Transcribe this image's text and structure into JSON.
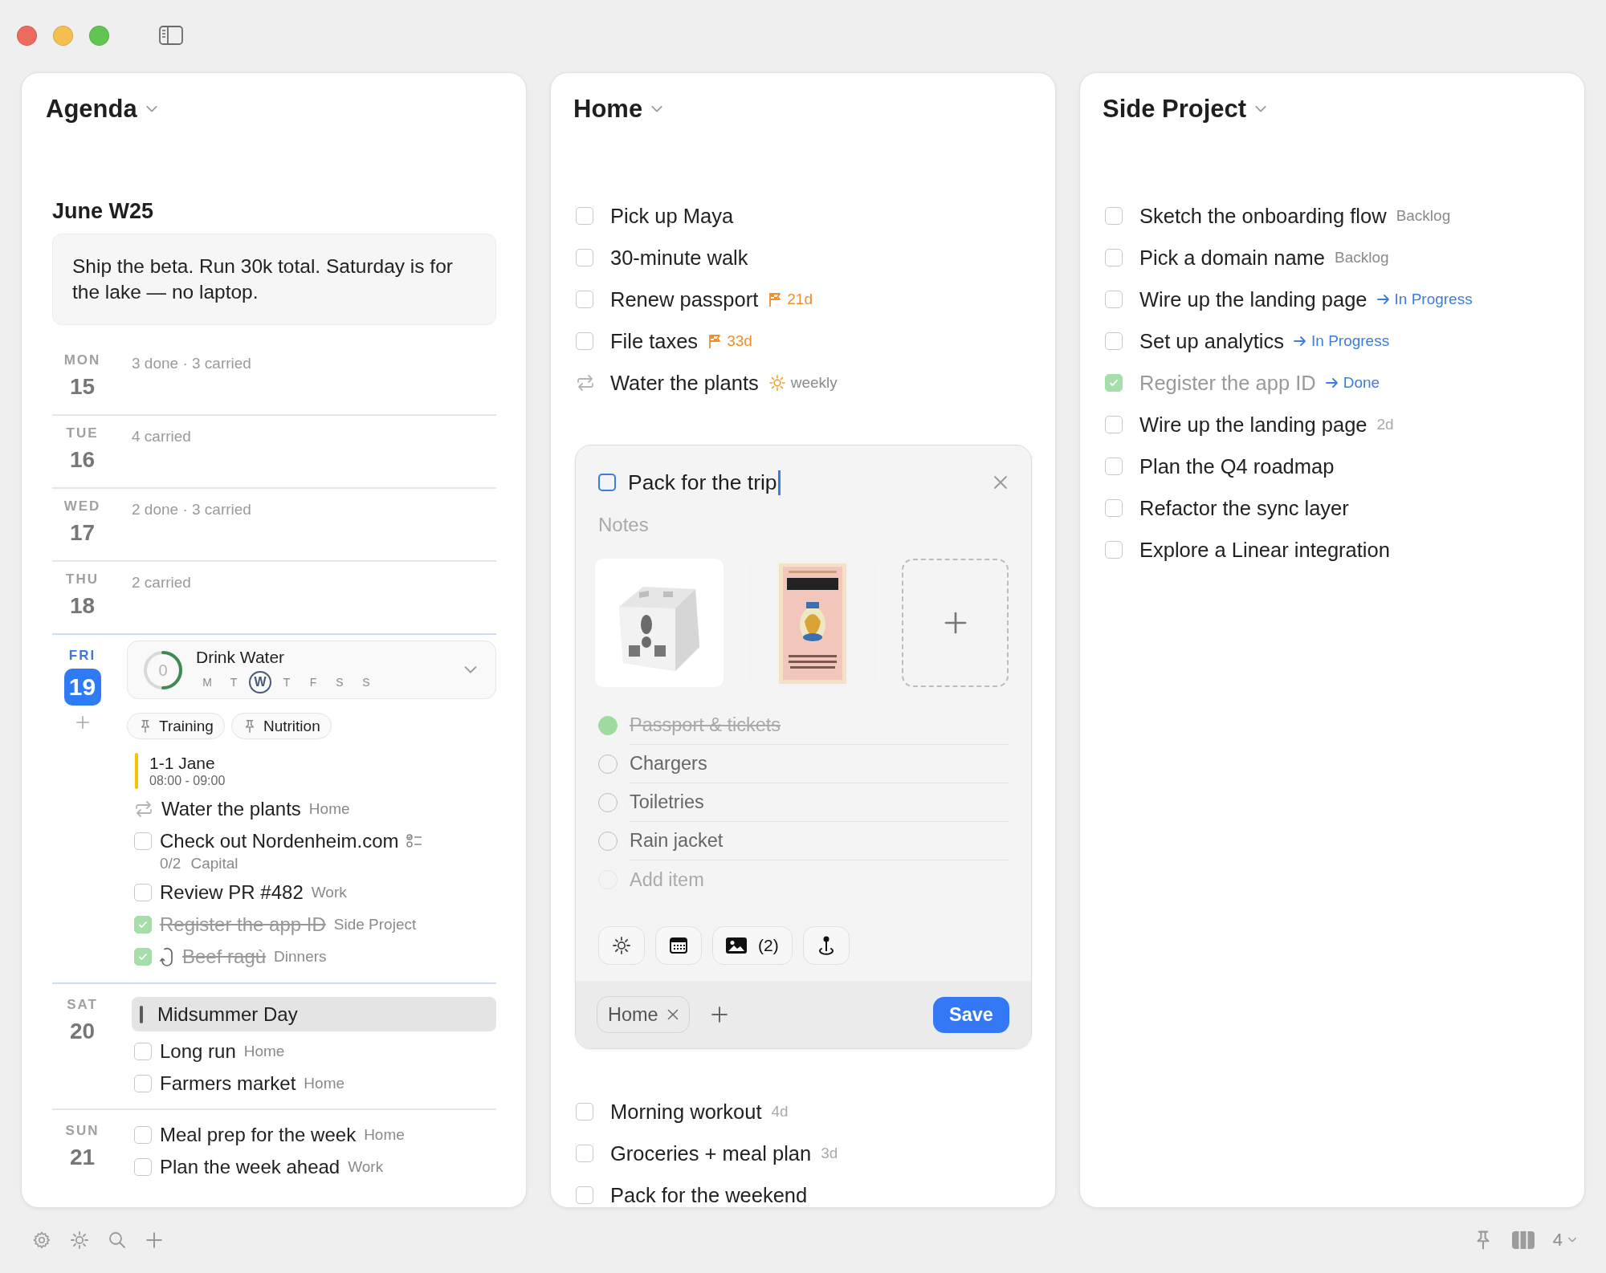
{
  "agenda": {
    "title": "Agenda",
    "week": "June W25",
    "note": "Ship the beta. Run 30k total. Saturday is for the lake — no laptop.",
    "days": [
      {
        "weekday": "MON",
        "date": "15",
        "today": false,
        "summary": "3 done · 3 carried"
      },
      {
        "weekday": "TUE",
        "date": "16",
        "today": false,
        "summary": "4 carried"
      },
      {
        "weekday": "WED",
        "date": "17",
        "today": false,
        "summary": "2 done · 3 carried"
      },
      {
        "weekday": "THU",
        "date": "18",
        "today": false,
        "summary": "2 carried"
      },
      {
        "weekday": "FRI",
        "date": "19",
        "today": true,
        "habit": {
          "name": "Drink Water",
          "count": "0",
          "days": [
            {
              "label": "M",
              "selected": false
            },
            {
              "label": "T",
              "selected": false
            },
            {
              "label": "W",
              "selected": true
            },
            {
              "label": "T",
              "selected": false
            },
            {
              "label": "F",
              "selected": false
            },
            {
              "label": "S",
              "selected": false
            },
            {
              "label": "S",
              "selected": false
            }
          ]
        },
        "pinned": [
          "Training",
          "Nutrition"
        ],
        "items": [
          {
            "kind": "event",
            "title": "1-1 Jane",
            "time": "08:00 - 09:00",
            "color": "#f5c400"
          },
          {
            "kind": "repeat",
            "title": "Water the plants",
            "meta": {
              "kind": "list",
              "text": "Home"
            }
          },
          {
            "kind": "task",
            "title": "Check out Nordenheim.com",
            "checked": false,
            "recurring": false,
            "subtasks": "0/2",
            "meta": {
              "kind": "list",
              "text": "Capital"
            }
          },
          {
            "kind": "task",
            "title": "Review PR #482",
            "checked": false,
            "recurring": false,
            "meta": {
              "kind": "list",
              "text": "Work"
            }
          },
          {
            "kind": "task",
            "title": "Register the app ID",
            "checked": true,
            "recurring": false,
            "meta": {
              "kind": "list",
              "text": "Side Project"
            }
          },
          {
            "kind": "task",
            "title": "Beef ragù",
            "checked": true,
            "recurring": true,
            "meta": {
              "kind": "list",
              "text": "Dinners"
            }
          }
        ]
      },
      {
        "weekday": "SAT",
        "date": "20",
        "today": false,
        "items": [
          {
            "kind": "holiday",
            "title": "Midsummer Day"
          },
          {
            "kind": "task",
            "title": "Long run",
            "checked": false,
            "recurring": false,
            "meta": {
              "kind": "list",
              "text": "Home"
            }
          },
          {
            "kind": "task",
            "title": "Farmers market",
            "checked": false,
            "recurring": false,
            "meta": {
              "kind": "list",
              "text": "Home"
            }
          }
        ]
      },
      {
        "weekday": "SUN",
        "date": "21",
        "today": false,
        "items": [
          {
            "kind": "task",
            "title": "Meal prep for the week",
            "checked": false,
            "recurring": false,
            "meta": {
              "kind": "list",
              "text": "Home"
            }
          },
          {
            "kind": "task",
            "title": "Plan the week ahead",
            "checked": false,
            "recurring": false,
            "meta": {
              "kind": "list",
              "text": "Work"
            }
          }
        ]
      }
    ]
  },
  "lists": [
    {
      "title": "Home",
      "items": [
        {
          "kind": "task",
          "title": "Pick up Maya",
          "checked": false
        },
        {
          "kind": "task",
          "title": "30-minute walk",
          "checked": false
        },
        {
          "kind": "task",
          "title": "Renew passport",
          "checked": false,
          "meta": {
            "kind": "deadline",
            "text": "21d"
          }
        },
        {
          "kind": "task",
          "title": "File taxes",
          "checked": false,
          "meta": {
            "kind": "deadline",
            "text": "33d"
          }
        },
        {
          "kind": "repeat",
          "title": "Water the plants",
          "meta": {
            "kind": "recurrence",
            "text": "weekly"
          }
        },
        {
          "kind": "editor",
          "title": "Pack for the trip",
          "checked": false,
          "notes": {
            "placeholder": "Notes"
          },
          "attachments": [
            {
              "kind": "picture"
            },
            {
              "kind": "picture"
            }
          ],
          "checklist": [
            {
              "text": "Passport & tickets",
              "done": true
            },
            {
              "text": "Chargers",
              "done": false
            },
            {
              "text": "Toiletries",
              "done": false
            },
            {
              "text": "Rain jacket",
              "done": false
            }
          ],
          "add_item": {
            "placeholder": "Add item"
          },
          "photo_count": "(2)",
          "tags": [
            "Home"
          ],
          "save_label": "Save"
        },
        {
          "kind": "task",
          "title": "Morning workout",
          "checked": false,
          "meta": {
            "kind": "age",
            "text": "4d"
          }
        },
        {
          "kind": "task",
          "title": "Groceries + meal plan",
          "checked": false,
          "meta": {
            "kind": "age",
            "text": "3d"
          }
        },
        {
          "kind": "task",
          "title": "Pack for the weekend",
          "checked": false
        }
      ]
    },
    {
      "title": "Side Project",
      "items": [
        {
          "kind": "task",
          "title": "Sketch the onboarding flow",
          "checked": false,
          "meta": {
            "kind": "list",
            "text": "Backlog"
          }
        },
        {
          "kind": "task",
          "title": "Pick a domain name",
          "checked": false,
          "meta": {
            "kind": "list",
            "text": "Backlog"
          }
        },
        {
          "kind": "task",
          "title": "Wire up the landing page",
          "checked": false,
          "meta": {
            "kind": "status",
            "text": "In Progress"
          }
        },
        {
          "kind": "task",
          "title": "Set up analytics",
          "checked": false,
          "meta": {
            "kind": "status",
            "text": "In Progress"
          }
        },
        {
          "kind": "task",
          "title": "Register the app ID",
          "checked": true,
          "meta": {
            "kind": "status",
            "text": "Done"
          }
        },
        {
          "kind": "task",
          "title": "Wire up the landing page",
          "checked": false,
          "meta": {
            "kind": "age",
            "text": "2d"
          }
        },
        {
          "kind": "task",
          "title": "Plan the Q4 roadmap",
          "checked": false
        },
        {
          "kind": "task",
          "title": "Refactor the sync layer",
          "checked": false
        },
        {
          "kind": "task",
          "title": "Explore a Linear integration",
          "checked": false
        }
      ]
    }
  ],
  "bottom_bar": {
    "column_count": "4"
  }
}
